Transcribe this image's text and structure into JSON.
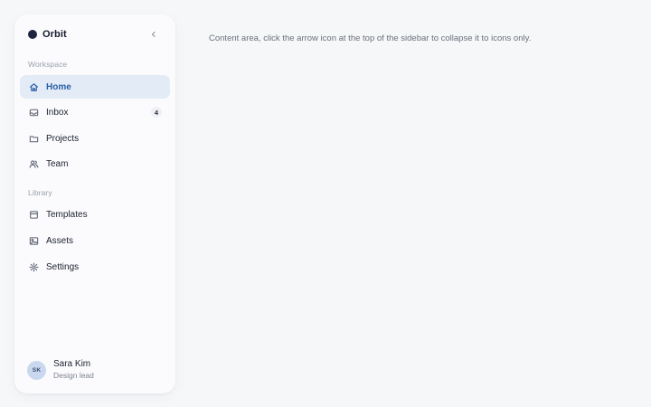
{
  "sidebar": {
    "brand": {
      "name": "Orbit",
      "dot_color": "#1d2440"
    },
    "collapse_icon": "chevron-left-icon",
    "sections": {
      "workspace": {
        "label": "Workspace"
      },
      "library": {
        "label": "Library"
      }
    },
    "items": [
      {
        "label": "Home",
        "icon": "home-icon",
        "active": true
      },
      {
        "label": "Inbox",
        "icon": "inbox-icon",
        "badge": "4"
      },
      {
        "label": "Projects",
        "icon": "folder-icon"
      },
      {
        "label": "Team",
        "icon": "users-icon"
      },
      {
        "label": "Templates",
        "icon": "template-icon"
      },
      {
        "label": "Assets",
        "icon": "image-icon"
      },
      {
        "label": "Settings",
        "icon": "gear-icon"
      }
    ],
    "user": {
      "initials": "SK",
      "name": "Sara Kim",
      "role": "Design lead"
    }
  },
  "content": {
    "text": "Content area, click the arrow icon at the top of the sidebar to collapse it to icons only."
  },
  "colors": {
    "accent": "#2a5fa8",
    "active_bg": "#e3ebf6",
    "page_bg": "#f6f7f9",
    "sidebar_bg": "#fbfbfd"
  }
}
